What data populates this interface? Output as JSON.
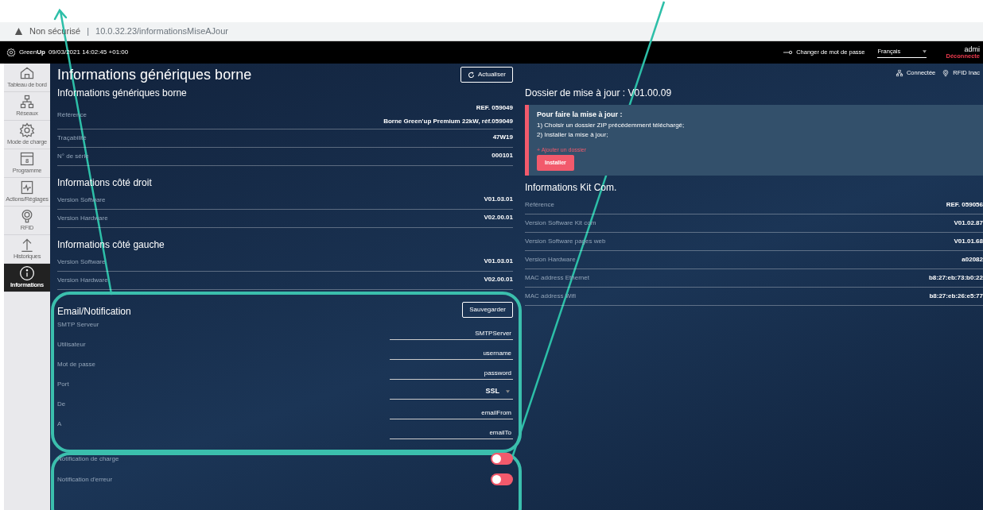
{
  "browser": {
    "security": "Non sécurisé",
    "separator": "|",
    "url": "10.0.32.23/informationsMiseAJour"
  },
  "header": {
    "brand_light": "Green",
    "brand_bold": "Up",
    "datetime": "09/03/2021 14:02:45 +01:00",
    "change_password": "Changer de mot de passe",
    "language": "Français",
    "user": "admi",
    "logout": "Déconnecte"
  },
  "sidebar": {
    "items": [
      {
        "label": "Tableau de bord",
        "kind": "home",
        "selected": false
      },
      {
        "label": "Réseaux",
        "kind": "network",
        "selected": false
      },
      {
        "label": "Mode de charge",
        "kind": "gear",
        "selected": false
      },
      {
        "label": "Programme",
        "kind": "calendar",
        "icon_text": "8",
        "selected": false
      },
      {
        "label": "Actions/Réglages",
        "kind": "chart",
        "selected": false
      },
      {
        "label": "RFID",
        "kind": "rfid",
        "selected": false
      },
      {
        "label": "Historiques",
        "kind": "upload",
        "selected": false
      },
      {
        "label": "Informations",
        "kind": "info",
        "selected": true
      }
    ]
  },
  "page_title": "Informations génériques borne",
  "refresh_button": "Actualiser",
  "status": [
    {
      "kind": "network",
      "label": "Connectée"
    },
    {
      "kind": "rfid",
      "label": "RFID Inac"
    }
  ],
  "left_sections": [
    {
      "title": "Informations génériques borne",
      "rows": [
        {
          "label": "Référence",
          "values": [
            "REF. 059049",
            "Borne Green'up Premium 22kW, réf.059049"
          ]
        },
        {
          "label": "Traçabilité",
          "values": [
            "47W19"
          ]
        },
        {
          "label": "N° de série",
          "values": [
            "000101"
          ]
        }
      ]
    },
    {
      "title": "Informations côté droit",
      "rows": [
        {
          "label": "Version Software",
          "values": [
            "V01.03.01"
          ]
        },
        {
          "label": "Version Hardware",
          "values": [
            "V02.00.01"
          ]
        }
      ]
    },
    {
      "title": "Informations côté gauche",
      "rows": [
        {
          "label": "Version Software",
          "values": [
            "V01.03.01"
          ]
        },
        {
          "label": "Version Hardware",
          "values": [
            "V02.00.01"
          ]
        }
      ]
    }
  ],
  "email": {
    "title": "Email/Notification",
    "save_button": "Sauvegarder",
    "fields": [
      {
        "label": "SMTP Serveur",
        "value": "SMTPServer",
        "kind": "text"
      },
      {
        "label": "Utilisateur",
        "value": "username",
        "kind": "text"
      },
      {
        "label": "Mot de passe",
        "value": "password",
        "kind": "text"
      },
      {
        "label": "Port",
        "value": "SSL",
        "kind": "select"
      },
      {
        "label": "De",
        "value": "emailFrom",
        "kind": "text"
      },
      {
        "label": "A",
        "value": "emailTo",
        "kind": "text"
      }
    ],
    "toggles": [
      {
        "label": "Notification de charge",
        "on": false
      },
      {
        "label": "Notification d'erreur",
        "on": false
      }
    ]
  },
  "update": {
    "title": "Dossier de mise à jour : V01.00.09",
    "instructions_title": "Pour faire la mise à jour :",
    "steps": [
      "1) Choisir un dossier ZIP précédemment téléchargé;",
      "2) Installer la mise à jour;"
    ],
    "add_folder": "+ Ajouter un dossier",
    "install_button": "Installer"
  },
  "kit": {
    "title": "Informations Kit Com.",
    "rows": [
      {
        "label": "Référence",
        "values": [
          "REF. 059056"
        ]
      },
      {
        "label": "Version Software Kit com",
        "values": [
          "V01.02.87"
        ]
      },
      {
        "label": "Version Software pages web",
        "values": [
          "V01.01.68"
        ]
      },
      {
        "label": "Version Hardware",
        "values": [
          "a02082"
        ]
      },
      {
        "label": "MAC address Ethernet",
        "values": [
          "b8:27:eb:73:b0:22"
        ]
      },
      {
        "label": "MAC address Wifi",
        "values": [
          "b8:27:eb:26:e5:77"
        ]
      }
    ]
  }
}
